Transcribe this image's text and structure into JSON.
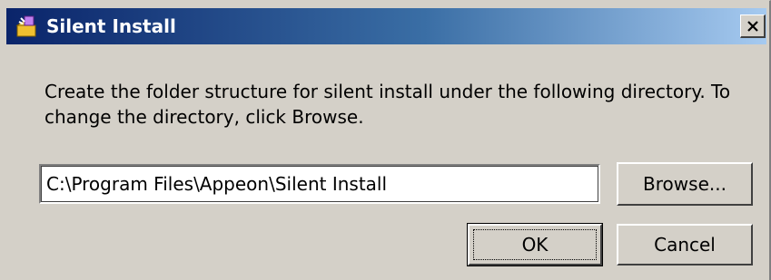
{
  "window": {
    "title": "Silent Install",
    "close_icon": "close-icon",
    "app_icon": "install-folder-icon"
  },
  "dialog": {
    "message": "Create the folder structure for silent install under the following directory.  To change the directory, click Browse.",
    "directory": {
      "value": "C:\\Program Files\\Appeon\\Silent Install"
    },
    "buttons": {
      "browse": "Browse...",
      "ok": "OK",
      "cancel": "Cancel"
    }
  },
  "colors": {
    "titlebar_start": "#0a246a",
    "titlebar_end": "#a6caf0",
    "face": "#d4d0c8"
  }
}
